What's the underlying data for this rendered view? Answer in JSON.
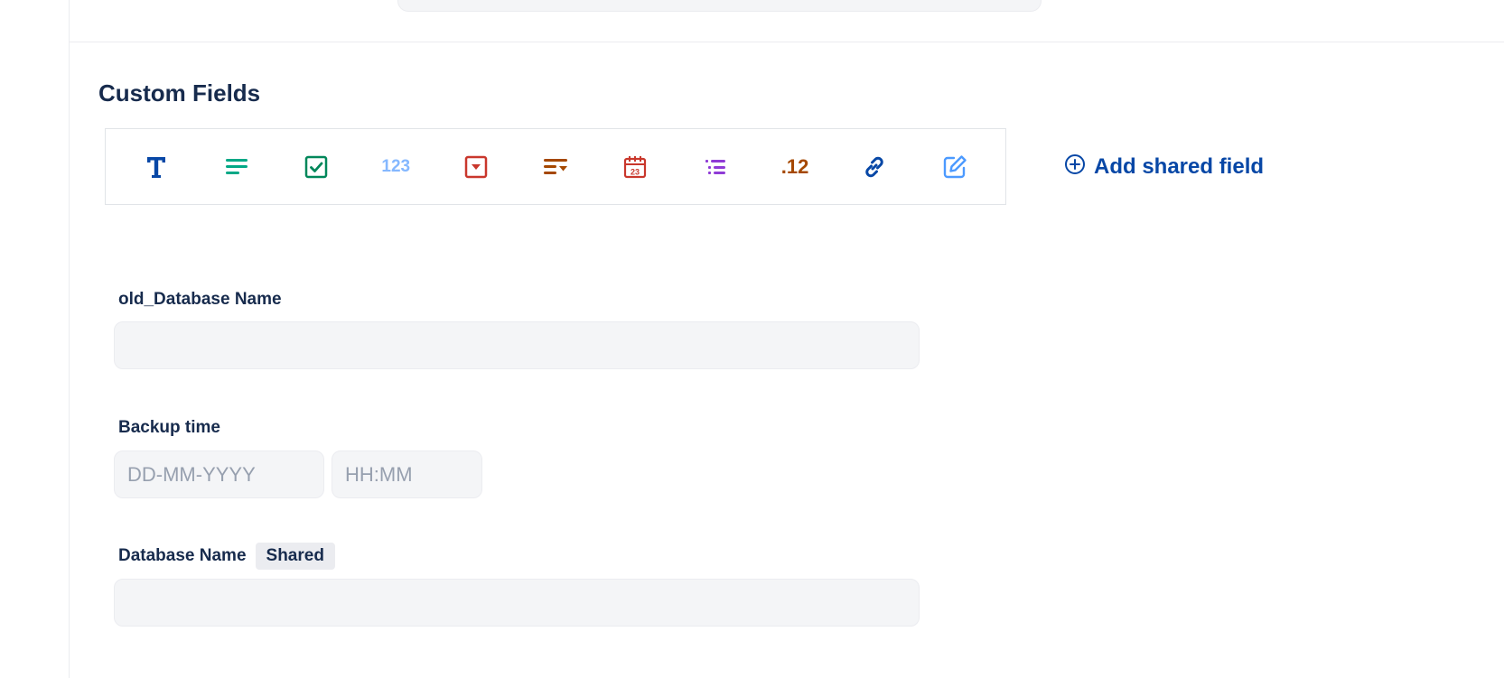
{
  "section": {
    "title": "Custom Fields"
  },
  "toolbar": {
    "items": [
      {
        "name": "text",
        "icon": "text-t-icon",
        "color": "#0747a6"
      },
      {
        "name": "paragraph",
        "icon": "paragraph-lines-icon",
        "color": "#00a886"
      },
      {
        "name": "checkbox",
        "icon": "checkbox-icon",
        "color": "#00875a"
      },
      {
        "name": "number",
        "icon": "number-icon",
        "label": "123",
        "color": "#85b8ff"
      },
      {
        "name": "dropdown",
        "icon": "dropdown-select-icon",
        "color": "#c9372c"
      },
      {
        "name": "multi-select",
        "icon": "multi-select-icon",
        "color": "#a54800"
      },
      {
        "name": "date",
        "icon": "calendar-icon",
        "label": "23",
        "color": "#c9372c"
      },
      {
        "name": "list",
        "icon": "list-icon",
        "color": "#8f3bd6"
      },
      {
        "name": "decimal",
        "icon": "decimal-icon",
        "label": ".12",
        "color": "#a54800"
      },
      {
        "name": "url",
        "icon": "link-icon",
        "color": "#0747a6"
      },
      {
        "name": "edit",
        "icon": "edit-icon",
        "color": "#4c9aff"
      }
    ]
  },
  "add_shared": {
    "label": "Add shared field",
    "icon": "plus-circle-icon",
    "color": "#0747a6"
  },
  "fields": {
    "old_database_name": {
      "label": "old_Database Name",
      "value": ""
    },
    "backup_time": {
      "label": "Backup time",
      "date_placeholder": "DD-MM-YYYY",
      "time_placeholder": "HH:MM"
    },
    "database_name": {
      "label": "Database Name",
      "badge": "Shared",
      "value": ""
    }
  }
}
